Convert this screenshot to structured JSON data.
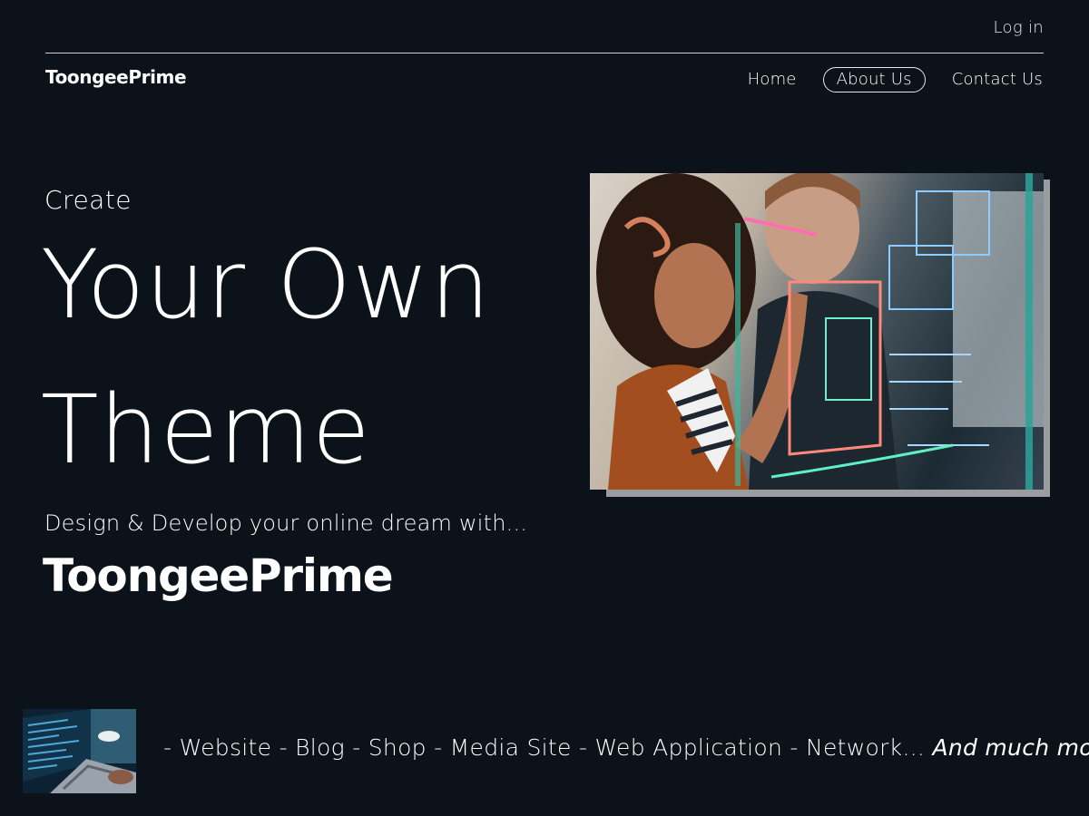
{
  "top_bar": {
    "login_label": "Log in"
  },
  "header": {
    "logo": "ToongeePrime",
    "nav": [
      {
        "label": "Home",
        "active": false
      },
      {
        "label": "About Us",
        "active": true
      },
      {
        "label": "Contact Us",
        "active": false
      }
    ]
  },
  "hero": {
    "eyebrow": "Create",
    "headline_line1": "Your Own",
    "headline_line2": "Theme",
    "tagline": "Design & Develop your online dream with...",
    "brand": "ToongeePrime",
    "image_icon": "people-at-glass-whiteboard-photo"
  },
  "features": {
    "thumbnail_icon": "laptop-code-photo",
    "list_text": "- Website - Blog - Shop - Media Site - Web Application - Network...",
    "emphasis": "And much more!"
  },
  "colors": {
    "background": "#0b121a",
    "text": "#ffffff",
    "divider": "#cfd3d8",
    "image_shadow": "#9a9ca0"
  }
}
